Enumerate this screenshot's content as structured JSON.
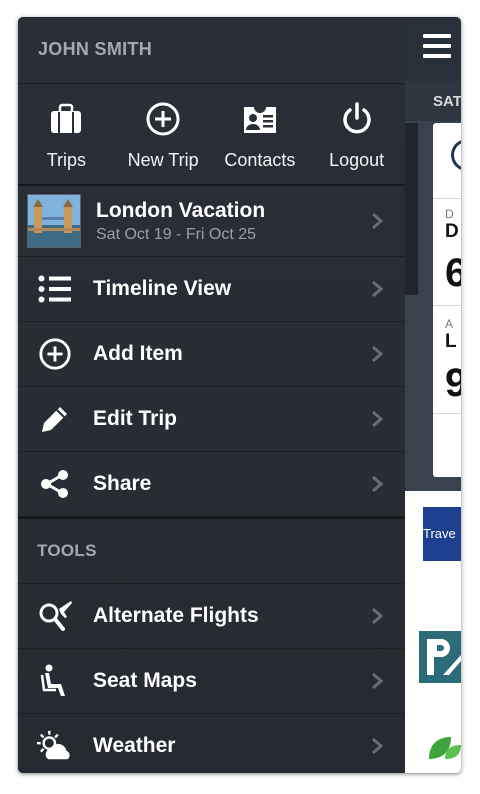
{
  "user": {
    "name": "JOHN SMITH"
  },
  "quick_actions": [
    {
      "label": "Trips",
      "icon": "briefcase-icon"
    },
    {
      "label": "New Trip",
      "icon": "plus-circle-icon"
    },
    {
      "label": "Contacts",
      "icon": "contact-card-icon"
    },
    {
      "label": "Logout",
      "icon": "power-icon"
    }
  ],
  "trip": {
    "title": "London Vacation",
    "dates": "Sat Oct 19 - Fri Oct 25"
  },
  "menu": [
    {
      "label": "Timeline View",
      "icon": "list-icon"
    },
    {
      "label": "Add Item",
      "icon": "plus-circle-icon"
    },
    {
      "label": "Edit Trip",
      "icon": "pencil-icon"
    },
    {
      "label": "Share",
      "icon": "share-icon"
    }
  ],
  "tools": {
    "heading": "TOOLS",
    "items": [
      {
        "label": "Alternate Flights",
        "icon": "search-plane-icon"
      },
      {
        "label": "Seat Maps",
        "icon": "seat-icon"
      },
      {
        "label": "Weather",
        "icon": "weather-icon"
      }
    ]
  },
  "content_peek": {
    "date_label": "SAT",
    "card_labels": [
      "D",
      "D",
      "6",
      "A",
      "L",
      "9"
    ],
    "ad_text": "Trave",
    "colors": {
      "topbar": "#28313a",
      "ad_blue": "#1d3f8f",
      "ad_teal": "#2c6c78",
      "leaf_green": "#3ea33a"
    }
  }
}
